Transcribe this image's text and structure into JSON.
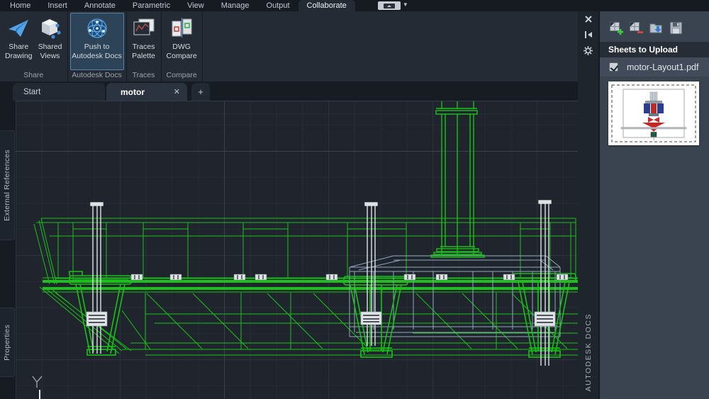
{
  "colors": {
    "wireframe_green": "#1ac119",
    "dome_blue": "#91a6bf",
    "post_white": "#dfe3e6",
    "canvas_bg": "#20252d",
    "palette_bg": "#3a4450",
    "selected_button_border": "#5a83a8"
  },
  "menubar": {
    "tabs": [
      "Home",
      "Insert",
      "Annotate",
      "Parametric",
      "View",
      "Manage",
      "Output",
      "Collaborate"
    ],
    "active_tab": "Collaborate"
  },
  "ribbon": {
    "groups": [
      {
        "label": "Share",
        "buttons": [
          {
            "line1": "Share",
            "line2": "Drawing",
            "icon": "share-drawing-icon"
          },
          {
            "line1": "Shared",
            "line2": "Views",
            "icon": "shared-views-icon"
          }
        ]
      },
      {
        "label": "Autodesk Docs",
        "buttons": [
          {
            "line1": "Push to",
            "line2": "Autodesk Docs",
            "icon": "push-to-docs-icon",
            "selected": true
          }
        ]
      },
      {
        "label": "Traces",
        "buttons": [
          {
            "line1": "Traces",
            "line2": "Palette",
            "icon": "traces-palette-icon"
          }
        ]
      },
      {
        "label": "Compare",
        "buttons": [
          {
            "line1": "DWG",
            "line2": "Compare",
            "icon": "dwg-compare-icon"
          }
        ]
      }
    ]
  },
  "filetabs": {
    "start_label": "Start",
    "active_doc_label": "motor",
    "close_glyph": "✕",
    "new_tab_glyph": "+"
  },
  "left_panel_tabs": {
    "external_references": "External References",
    "properties": "Properties"
  },
  "canvas": {
    "ucs_axis_label": "Y",
    "drawing_description": "green wireframe side elevation of motor tank assembly with column, dome and three hoppers"
  },
  "palette": {
    "title": "AUTODESK DOCS",
    "titlebar_icons": [
      "close-icon",
      "auto-hide-pin-icon",
      "properties-gear-icon"
    ],
    "toolbar_icons": [
      "add-sheets-icon",
      "remove-sheets-icon",
      "load-sheet-list-icon",
      "save-sheet-list-icon"
    ],
    "header": "Sheets to Upload",
    "sheet": {
      "checked": true,
      "name": "motor-Layout1.pdf"
    }
  }
}
